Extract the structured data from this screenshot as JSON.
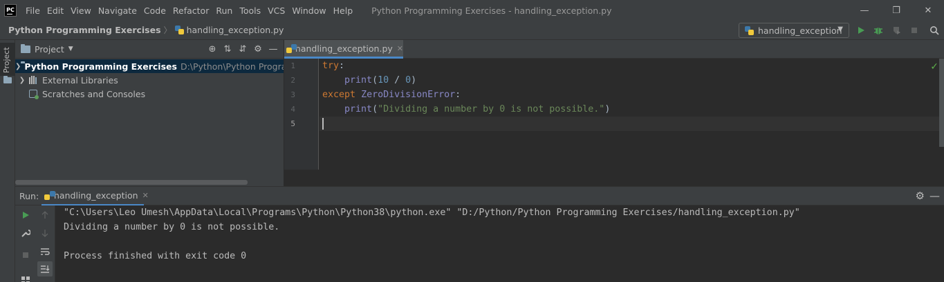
{
  "menubar": {
    "logo_text": "PC",
    "items": [
      "File",
      "Edit",
      "View",
      "Navigate",
      "Code",
      "Refactor",
      "Run",
      "Tools",
      "VCS",
      "Window",
      "Help"
    ],
    "window_title": "Python Programming Exercises - handling_exception.py",
    "controls": {
      "minimize": "—",
      "restore": "❐",
      "close": "✕"
    }
  },
  "navbar": {
    "project": "Python Programming Exercises",
    "file": "handling_exception.py",
    "run_config": "handling_exception",
    "tool_icons": [
      "run-icon",
      "debug-icon",
      "coverage-icon",
      "stop-icon",
      "search-icon"
    ],
    "colors": {
      "run": "#499c54",
      "debug": "#499c54"
    }
  },
  "left_stripe": {
    "tab_label": "Project"
  },
  "project_panel": {
    "title": "Project",
    "tools": {
      "locate": "⊕",
      "expand": "⇅",
      "collapse": "⇵",
      "settings": "⚙",
      "hide": "—"
    },
    "tree": [
      {
        "label": "Python Programming Exercises",
        "path": "D:\\Python\\Python Programmin",
        "selected": true
      },
      {
        "label": "External Libraries"
      },
      {
        "label": "Scratches and Consoles"
      }
    ]
  },
  "editor": {
    "tab": {
      "name": "handling_exception.py",
      "close": "✕"
    },
    "line_numbers": [
      "1",
      "2",
      "3",
      "4",
      "5"
    ],
    "current_line": "5",
    "code": {
      "l1_kw": "try",
      "l1_punct": ":",
      "l2_fn": "print",
      "l2_open": "(",
      "l2_num1": "10",
      "l2_op": " / ",
      "l2_num2": "0",
      "l2_close": ")",
      "l3_kw": "except",
      "l3_cls": "ZeroDivisionError",
      "l3_punct": ":",
      "l4_fn": "print",
      "l4_open": "(",
      "l4_str": "\"Dividing a number by 0 is not possible.\"",
      "l4_close": ")"
    },
    "inspection_status": "✓",
    "colors": {
      "keyword": "#cc7832",
      "builtin": "#8888c6",
      "number": "#6897bb",
      "string": "#6a8759",
      "check": "#5daf4a"
    }
  },
  "run_panel": {
    "label": "Run:",
    "tab": {
      "name": "handling_exception",
      "close": "✕"
    },
    "gear": "⚙",
    "minimize": "—",
    "console_lines": [
      "\"C:\\Users\\Leo Umesh\\AppData\\Local\\Programs\\Python\\Python38\\python.exe\" \"D:/Python/Python Programming Exercises/handling_exception.py\"",
      "Dividing a number by 0 is not possible.",
      "",
      "Process finished with exit code 0"
    ],
    "tool_icons": [
      "rerun-icon",
      "up-icon",
      "wrench-icon",
      "down-icon",
      "stop-icon",
      "soft-wrap-icon",
      "scroll-to-end-icon",
      "layout-icon"
    ]
  }
}
